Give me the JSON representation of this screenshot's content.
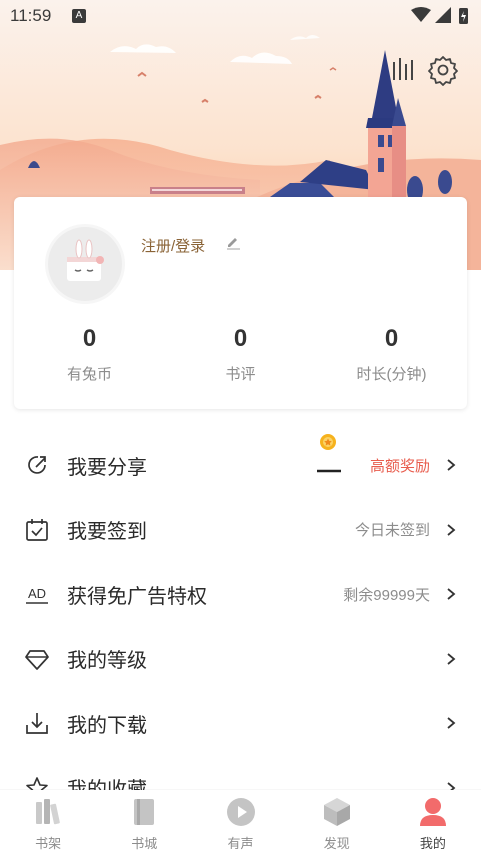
{
  "status_bar": {
    "time": "11:59",
    "badge": "A"
  },
  "header": {
    "listen_icon": "audio-bars-icon",
    "settings_icon": "gear-icon"
  },
  "profile": {
    "avatar_icon": "rabbit-cake-avatar",
    "login_label": "注册/登录",
    "edit_icon": "pencil-icon",
    "stats": [
      {
        "value": "0",
        "label": "有兔币"
      },
      {
        "value": "0",
        "label": "书评"
      },
      {
        "value": "0",
        "label": "时长(分钟)"
      }
    ]
  },
  "menu": [
    {
      "icon": "share-icon",
      "label": "我要分享",
      "value": "高额奖励",
      "highlight": true
    },
    {
      "icon": "calendar-check-icon",
      "label": "我要签到",
      "value": "今日未签到"
    },
    {
      "icon": "ad-icon",
      "label": "获得免广告特权",
      "value": "剩余99999天"
    },
    {
      "icon": "diamond-icon",
      "label": "我的等级",
      "value": ""
    },
    {
      "icon": "download-icon",
      "label": "我的下载",
      "value": ""
    },
    {
      "icon": "star-icon",
      "label": "我的收藏",
      "value": ""
    }
  ],
  "bottom_nav": [
    {
      "icon": "bookshelf-icon",
      "label": "书架"
    },
    {
      "icon": "book-icon",
      "label": "书城"
    },
    {
      "icon": "play-icon",
      "label": "有声"
    },
    {
      "icon": "cube-icon",
      "label": "发现"
    },
    {
      "icon": "person-icon",
      "label": "我的",
      "active": true
    }
  ],
  "colors": {
    "accent": "#e85d4e",
    "login": "#8a6336",
    "nav_active": "#f26b6b"
  }
}
